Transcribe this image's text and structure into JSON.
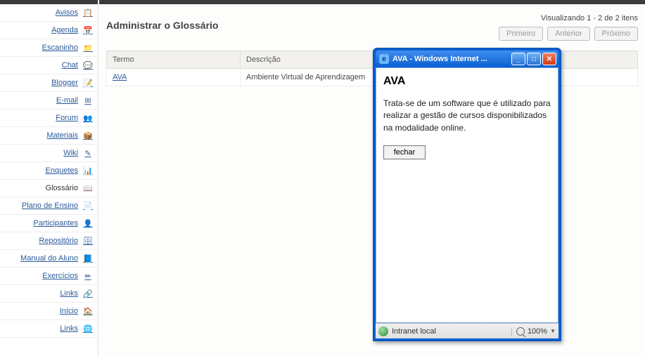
{
  "sidebar": {
    "items": [
      {
        "label": "Avisos",
        "icon": "📋"
      },
      {
        "label": "Agenda",
        "icon": "📅"
      },
      {
        "label": "Escaninho",
        "icon": "📁"
      },
      {
        "label": "Chat",
        "icon": "💬"
      },
      {
        "label": "Blogger",
        "icon": "📝"
      },
      {
        "label": "E-mail",
        "icon": "✉"
      },
      {
        "label": "Forum",
        "icon": "👥"
      },
      {
        "label": "Materiais",
        "icon": "📦"
      },
      {
        "label": "Wiki",
        "icon": "✎"
      },
      {
        "label": "Enquetes",
        "icon": "📊"
      },
      {
        "label": "Glossário",
        "icon": "📖"
      },
      {
        "label": "Plano de Ensino",
        "icon": "📄"
      },
      {
        "label": "Participantes",
        "icon": "👤"
      },
      {
        "label": "Repositório",
        "icon": "🗄"
      },
      {
        "label": "Manual do Aluno",
        "icon": "📘"
      },
      {
        "label": "Exercícios",
        "icon": "✏"
      },
      {
        "label": "Links",
        "icon": "🔗"
      },
      {
        "label": "Início",
        "icon": "🏠"
      },
      {
        "label": "Links",
        "icon": "🌐"
      }
    ],
    "active_index": 10
  },
  "main": {
    "title": "Administrar o Glossário",
    "pager_text": "Visualizando 1 - 2 de 2 itens",
    "buttons": {
      "first": "Primeiro",
      "prev": "Anterior",
      "next": "Próximo"
    },
    "columns": {
      "term": "Termo",
      "desc": "Descrição"
    },
    "rows": [
      {
        "term": "AVA",
        "desc": "Ambiente Virtual de Aprendizagem"
      }
    ]
  },
  "popup": {
    "window_title": "AVA - Windows Internet ...",
    "heading": "AVA",
    "body": "Trata-se de um software que é utilizado para realizar a gestão de cursos disponibilizados na modalidade online.",
    "close_label": "fechar",
    "status": {
      "zone": "Intranet local",
      "zoom": "100%"
    }
  }
}
